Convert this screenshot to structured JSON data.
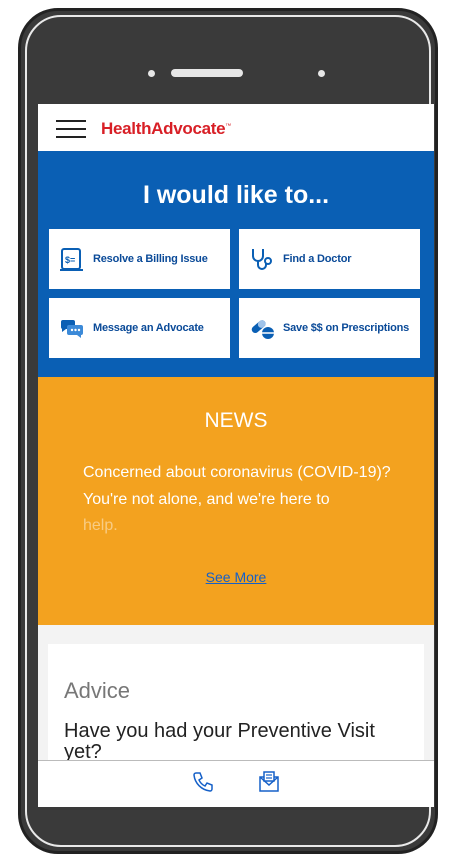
{
  "header": {
    "logo": "HealthAdvocate",
    "logo_tm": "™"
  },
  "actions": {
    "title": "I would like to...",
    "items": [
      {
        "label": "Resolve a Billing Issue",
        "icon": "billing-icon"
      },
      {
        "label": "Find a Doctor",
        "icon": "stethoscope-icon"
      },
      {
        "label": "Message an Advocate",
        "icon": "chat-bubbles-icon"
      },
      {
        "label": "Save $$ on Prescriptions",
        "icon": "pills-icon"
      }
    ]
  },
  "news": {
    "title": "NEWS",
    "text": "Concerned about coronavirus (COVID-19)? You're not alone, and we're here to",
    "text_faded": "help.",
    "link": "See More"
  },
  "advice": {
    "label": "Advice",
    "question": "Have you had your Preventive Visit yet?"
  },
  "tabbar": {
    "icons": [
      "phone-icon",
      "mail-icon"
    ]
  },
  "colors": {
    "brand_blue": "#0a5fb4",
    "news_orange": "#f3a21f",
    "logo_red": "#d81f26"
  }
}
